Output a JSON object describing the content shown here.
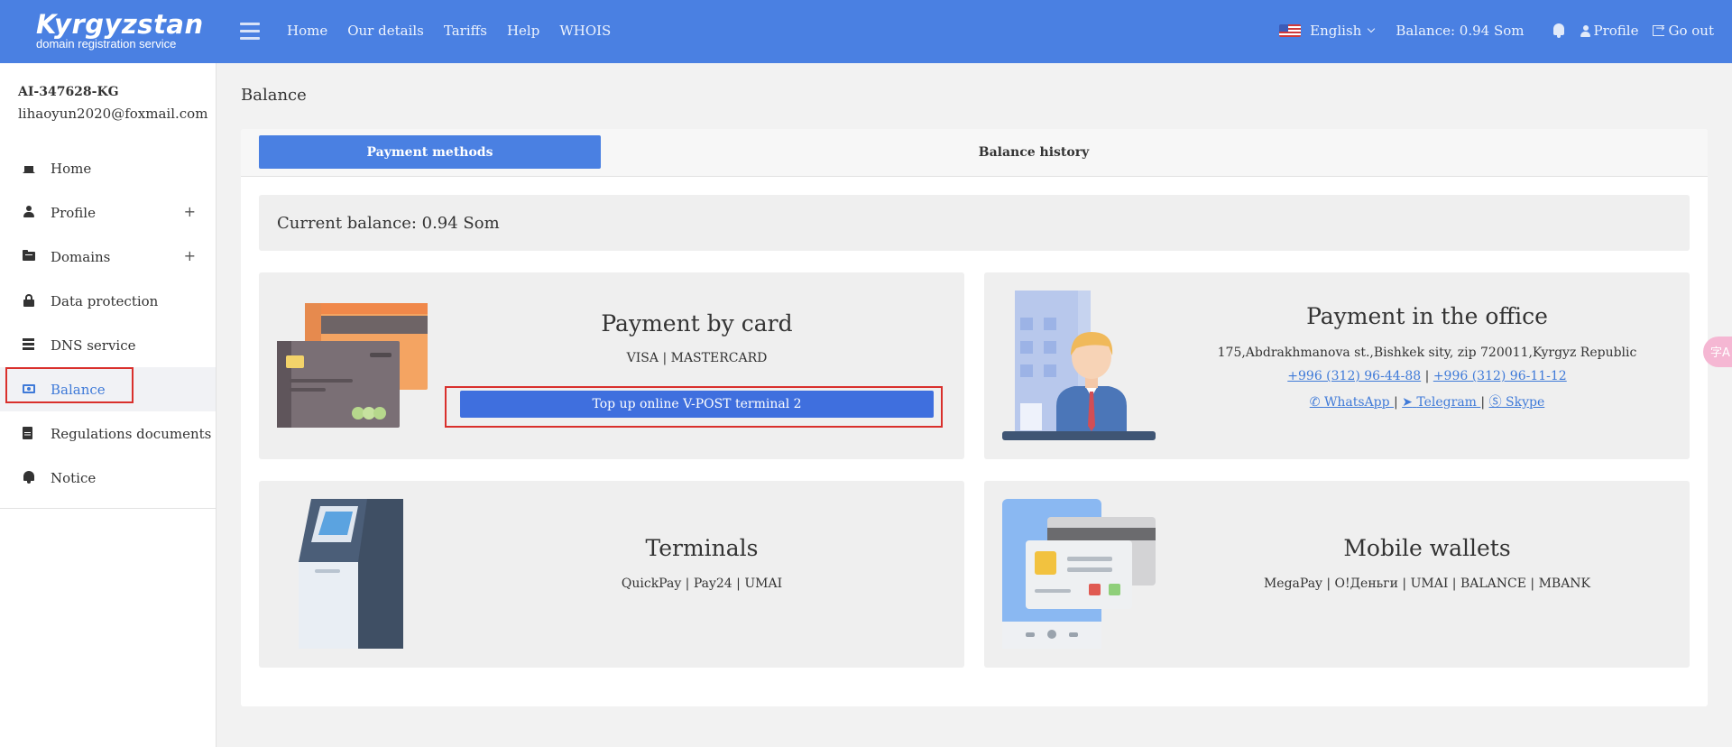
{
  "header": {
    "logo_main": "Kyrgyzstan",
    "logo_sub": "domain registration service",
    "nav": [
      "Home",
      "Our details",
      "Tariffs",
      "Help",
      "WHOIS"
    ],
    "language": "English",
    "balance": "Balance: 0.94 Som",
    "profile": "Profile",
    "logout": "Go out"
  },
  "sidebar": {
    "account_id": "AI-347628-KG",
    "email": "lihaoyun2020@foxmail.com",
    "items": [
      {
        "label": "Home",
        "icon": "home-icon"
      },
      {
        "label": "Profile",
        "icon": "user-icon",
        "expandable": true
      },
      {
        "label": "Domains",
        "icon": "folder-icon",
        "expandable": true
      },
      {
        "label": "Data protection",
        "icon": "lock-icon"
      },
      {
        "label": "DNS service",
        "icon": "server-icon"
      },
      {
        "label": "Balance",
        "icon": "money-icon",
        "active": true
      },
      {
        "label": "Regulations documents",
        "icon": "document-icon"
      },
      {
        "label": "Notice",
        "icon": "bell-icon"
      }
    ]
  },
  "main": {
    "title": "Balance",
    "tabs": [
      {
        "label": "Payment methods",
        "active": true
      },
      {
        "label": "Balance history",
        "active": false
      }
    ],
    "current_balance": "Current balance: 0.94 Som",
    "cards": {
      "card": {
        "title": "Payment by card",
        "subtitle": "VISA | MASTERCARD",
        "button": "Top up online V-POST terminal 2"
      },
      "office": {
        "title": "Payment in the office",
        "address": "175,Abdrakhmanova st.,Bishkek sity, zip 720011,Kyrgyz Republic",
        "phone1": "+996 (312) 96-44-88",
        "phone2": "+996 (312) 96-11-12",
        "whatsapp": "WhatsApp",
        "telegram": "Telegram",
        "skype": "Skype",
        "sep": "|"
      },
      "terminals": {
        "title": "Terminals",
        "subtitle": "QuickPay | Pay24 | UMAI"
      },
      "wallets": {
        "title": "Mobile wallets",
        "subtitle": "MegaPay | О!Деньги | UMAI | BALANCE | MBANK"
      }
    }
  },
  "colors": {
    "primary": "#4a80e2",
    "button": "#3f6fde",
    "highlight": "#d9302c",
    "link": "#3f7ad8"
  }
}
